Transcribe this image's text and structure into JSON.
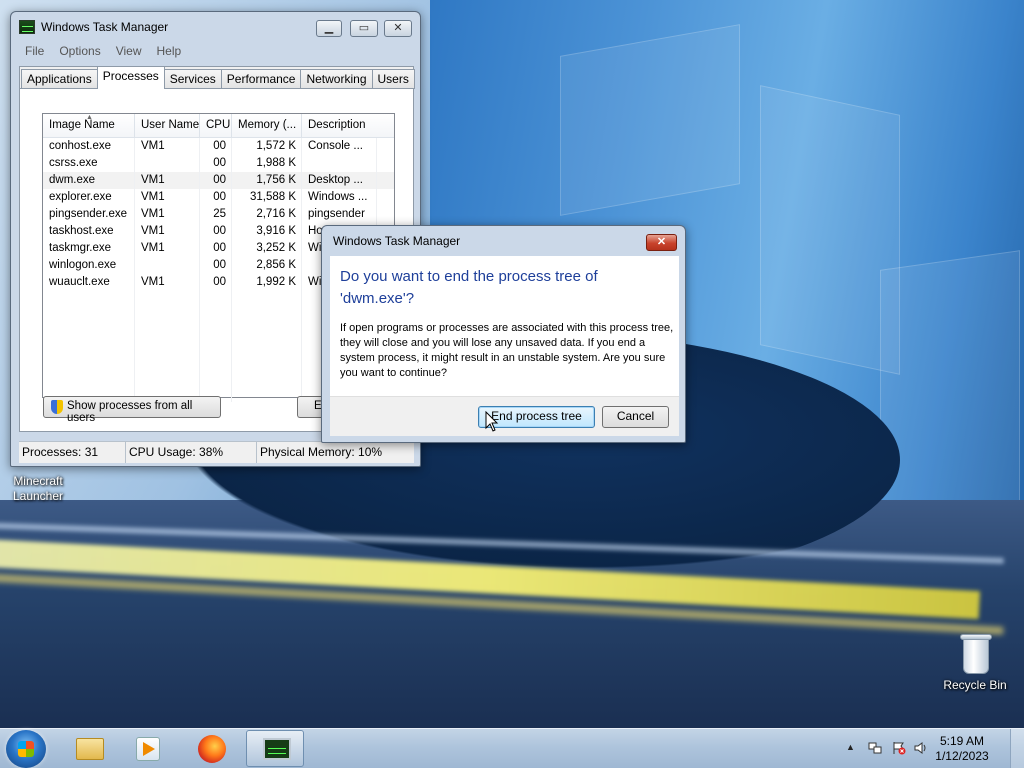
{
  "desktop": {
    "icons": [
      {
        "label_line1": "Minecraft",
        "label_line2": "Launcher"
      },
      {
        "label": "Recycle Bin"
      }
    ]
  },
  "task_manager": {
    "title": "Windows Task Manager",
    "menu": [
      "File",
      "Options",
      "View",
      "Help"
    ],
    "tabs": [
      "Applications",
      "Processes",
      "Services",
      "Performance",
      "Networking",
      "Users"
    ],
    "active_tab": "Processes",
    "columns": [
      "Image Name",
      "User Name",
      "CPU",
      "Memory (...",
      "Description"
    ],
    "rows": [
      {
        "name": "conhost.exe",
        "user": "VM1",
        "cpu": "00",
        "mem": "1,572 K",
        "desc": "Console ..."
      },
      {
        "name": "csrss.exe",
        "user": "",
        "cpu": "00",
        "mem": "1,988 K",
        "desc": ""
      },
      {
        "name": "dwm.exe",
        "user": "VM1",
        "cpu": "00",
        "mem": "1,756 K",
        "desc": "Desktop ..."
      },
      {
        "name": "explorer.exe",
        "user": "VM1",
        "cpu": "00",
        "mem": "31,588 K",
        "desc": "Windows ..."
      },
      {
        "name": "pingsender.exe",
        "user": "VM1",
        "cpu": "25",
        "mem": "2,716 K",
        "desc": "pingsender"
      },
      {
        "name": "taskhost.exe",
        "user": "VM1",
        "cpu": "00",
        "mem": "3,916 K",
        "desc": "Host Proc..."
      },
      {
        "name": "taskmgr.exe",
        "user": "VM1",
        "cpu": "00",
        "mem": "3,252 K",
        "desc": "Win..."
      },
      {
        "name": "winlogon.exe",
        "user": "",
        "cpu": "00",
        "mem": "2,856 K",
        "desc": ""
      },
      {
        "name": "wuauclt.exe",
        "user": "VM1",
        "cpu": "00",
        "mem": "1,992 K",
        "desc": "Win..."
      }
    ],
    "show_all_button": "Show processes from all users",
    "end_button_partial": "E",
    "status": {
      "processes": "Processes: 31",
      "cpu": "CPU Usage: 38%",
      "memory": "Physical Memory: 10%"
    }
  },
  "dialog": {
    "title": "Windows Task Manager",
    "heading": "Do you want to end the process tree of 'dwm.exe'?",
    "body": "If open programs or processes are associated with this process tree, they will close and you will lose any unsaved data. If you end a system process, it might result in an unstable system. Are you sure you want to continue?",
    "primary_button": "End process tree",
    "cancel_button": "Cancel"
  },
  "taskbar": {
    "apps": [
      "windows-explorer",
      "media-player",
      "firefox",
      "task-manager"
    ],
    "time": "5:19 AM",
    "date": "1/12/2023"
  }
}
